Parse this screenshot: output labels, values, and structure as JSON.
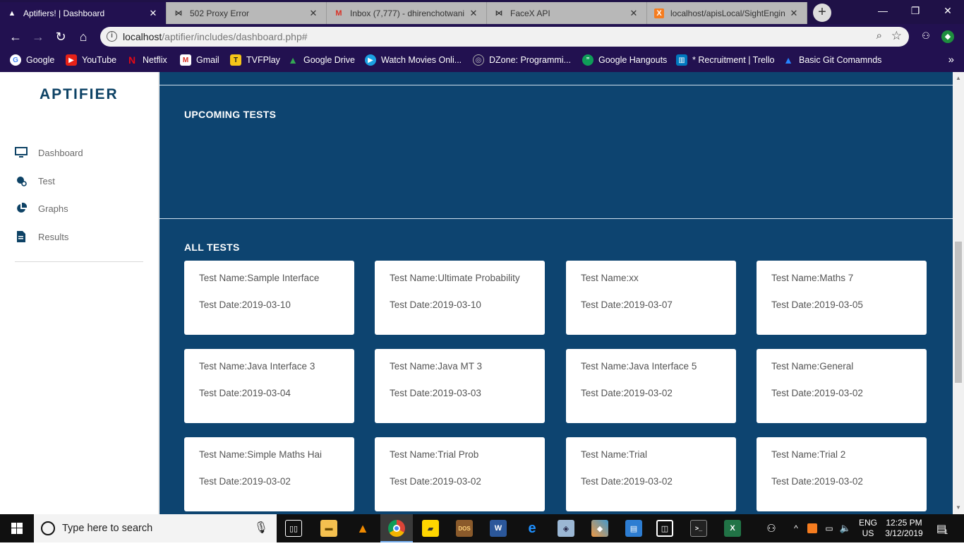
{
  "browser": {
    "tabs": [
      {
        "title": "Aptifiers! | Dashboard",
        "icon": "aptifier-icon",
        "active": true
      },
      {
        "title": "502 Proxy Error",
        "icon": "bowtie-icon",
        "active": false
      },
      {
        "title": "Inbox (7,777) - dhirenchotwani",
        "icon": "gmail-icon",
        "active": false
      },
      {
        "title": "FaceX API",
        "icon": "bowtie-icon",
        "active": false
      },
      {
        "title": "localhost/apisLocal/SightEngin",
        "icon": "xampp-icon",
        "active": false
      }
    ],
    "url_host": "localhost",
    "url_path": "/aptifier/includes/dashboard.php#",
    "bookmarks": [
      "Google",
      "YouTube",
      "Netflix",
      "Gmail",
      "TVFPlay",
      "Google Drive",
      "Watch Movies Onli...",
      "DZone: Programmi...",
      "Google Hangouts",
      "* Recruitment | Trello",
      "Basic Git Comamnds"
    ]
  },
  "sidebar": {
    "logo": "APTIFIER",
    "items": [
      {
        "label": "Dashboard",
        "icon": "monitor-icon"
      },
      {
        "label": "Test",
        "icon": "test-icon"
      },
      {
        "label": "Graphs",
        "icon": "pie-chart-icon"
      },
      {
        "label": "Results",
        "icon": "document-icon"
      }
    ]
  },
  "main": {
    "upcoming_title": "UPCOMING TESTS",
    "all_title": "ALL TESTS",
    "tests": [
      {
        "name": "Test Name:Sample Interface",
        "date": "Test Date:2019-03-10"
      },
      {
        "name": "Test Name:Ultimate Probability",
        "date": "Test Date:2019-03-10"
      },
      {
        "name": "Test Name:xx",
        "date": "Test Date:2019-03-07"
      },
      {
        "name": "Test Name:Maths 7",
        "date": "Test Date:2019-03-05"
      },
      {
        "name": "Test Name:Java Interface 3",
        "date": "Test Date:2019-03-04"
      },
      {
        "name": "Test Name:Java MT 3",
        "date": "Test Date:2019-03-03"
      },
      {
        "name": "Test Name:Java Interface 5",
        "date": "Test Date:2019-03-02"
      },
      {
        "name": "Test Name:General",
        "date": "Test Date:2019-03-02"
      },
      {
        "name": "Test Name:Simple Maths Hai",
        "date": "Test Date:2019-03-02"
      },
      {
        "name": "Test Name:Trial Prob",
        "date": "Test Date:2019-03-02"
      },
      {
        "name": "Test Name:Trial",
        "date": "Test Date:2019-03-02"
      },
      {
        "name": "Test Name:Trial 2",
        "date": "Test Date:2019-03-02"
      }
    ]
  },
  "taskbar": {
    "search_placeholder": "Type here to search",
    "language": "ENG",
    "region": "US",
    "time": "12:25 PM",
    "date": "3/12/2019",
    "notification_count": "1"
  },
  "colors": {
    "chrome_dark": "#221150",
    "main_bg": "#0d4470",
    "brand": "#0d4265"
  }
}
